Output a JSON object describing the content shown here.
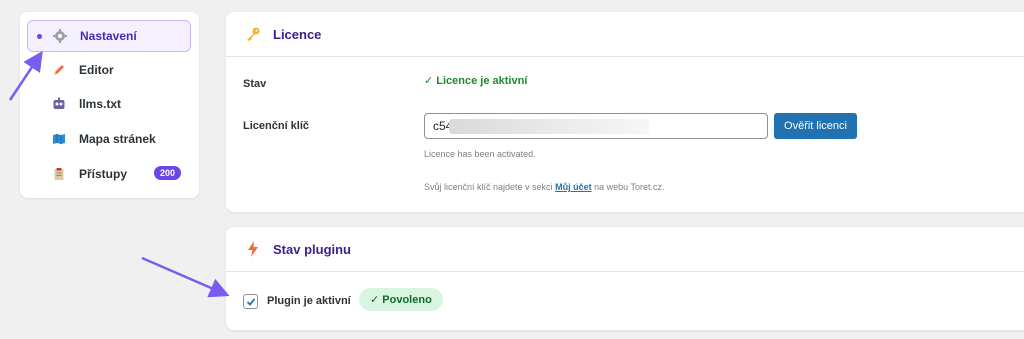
{
  "sidebar": {
    "items": [
      {
        "label": "Nastavení",
        "icon": "gear-icon",
        "active": true
      },
      {
        "label": "Editor",
        "icon": "pencil-icon"
      },
      {
        "label": "llms.txt",
        "icon": "robot-icon"
      },
      {
        "label": "Mapa stránek",
        "icon": "map-icon"
      },
      {
        "label": "Přístupy",
        "icon": "clipboard-icon",
        "badge": "200"
      }
    ]
  },
  "licence": {
    "title": "Licence",
    "icon": "key-icon",
    "status_label": "Stav",
    "status_value": "Licence je aktivní",
    "key_label": "Licenční klíč",
    "key_value": "c54",
    "verify_button": "Ověřit licenci",
    "activated_note": "Licence has been activated.",
    "help_prefix": "Svůj licenční klíč najdete v sekci",
    "help_link": "Můj účet",
    "help_suffix": "na webu Toret.cz."
  },
  "plugin": {
    "title": "Stav pluginu",
    "icon": "lightning-icon",
    "checkbox_label": "Plugin je aktivní",
    "checkbox_checked": true,
    "status_pill": "Povoleno"
  },
  "colors": {
    "accent": "#6b46e6",
    "title": "#3b1f8f",
    "success": "#1e8a2e",
    "button": "#2271b1"
  }
}
